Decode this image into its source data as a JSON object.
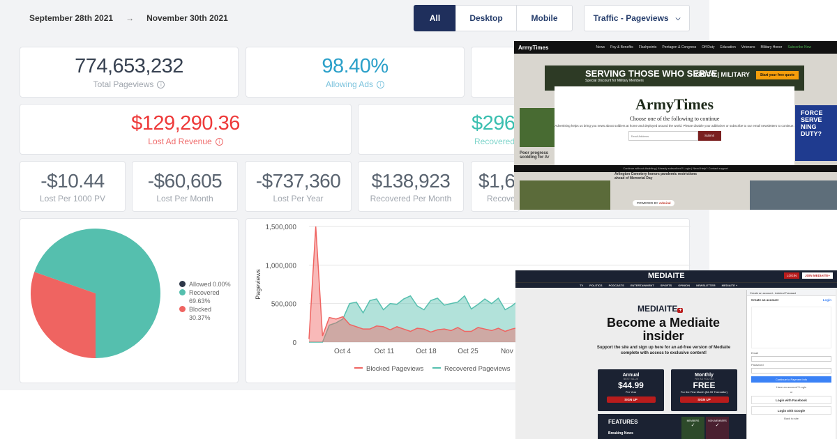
{
  "date_range": {
    "start": "September 28th 2021",
    "arrow": "→",
    "end": "November 30th 2021"
  },
  "device_filter": {
    "all": "All",
    "desktop": "Desktop",
    "mobile": "Mobile"
  },
  "metric_select": {
    "label": "Traffic - Pageviews"
  },
  "stats": {
    "total_pageviews": {
      "value": "774,653,232",
      "label": "Total Pageviews"
    },
    "allowing_ads": {
      "value": "98.40%",
      "label": "Allowing Ads"
    },
    "lost_ad_revenue": {
      "value": "$129,290.36",
      "label": "Lost Ad Revenue"
    },
    "recovered": {
      "value": "$296",
      "label": "Recovered"
    },
    "lost_per_1000": {
      "value": "-$10.44",
      "label": "Lost Per 1000 PV"
    },
    "lost_per_month": {
      "value": "-$60,605",
      "label": "Lost Per Month"
    },
    "lost_per_year": {
      "value": "-$737,360",
      "label": "Lost Per Year"
    },
    "recovered_per_month": {
      "value": "$138,923",
      "label": "Recovered Per Month"
    },
    "recovered_partial": {
      "value": "$1,6",
      "label": "Recove"
    }
  },
  "chart_data": [
    {
      "type": "pie",
      "labels": [
        "Allowed",
        "Recovered",
        "Blocked"
      ],
      "values": [
        0.0,
        69.63,
        30.37
      ],
      "value_labels": [
        "0.00%",
        "69.63%",
        "30.37%"
      ],
      "colors": [
        "#2d3748",
        "#55bfae",
        "#ef6461"
      ],
      "legend": "right"
    },
    {
      "type": "area",
      "ylabel": "Pageviews",
      "yticks": [
        "0",
        "500,000",
        "1,000,000",
        "1,500,000"
      ],
      "ylim": [
        0,
        1500000
      ],
      "xticks": [
        "Oct 4",
        "Oct 11",
        "Oct 18",
        "Oct 25",
        "Nov 1"
      ],
      "series": [
        {
          "name": "Blocked Pageviews",
          "color": "#ef6461",
          "values": [
            40000,
            1500000,
            80000,
            320000,
            300000,
            330000,
            230000,
            200000,
            170000,
            170000,
            210000,
            200000,
            160000,
            200000,
            170000,
            140000,
            180000,
            170000,
            130000,
            160000,
            170000,
            150000,
            190000,
            140000,
            140000,
            190000,
            170000,
            150000,
            180000,
            140000,
            170000,
            190000,
            160000,
            200000
          ]
        },
        {
          "name": "Recovered Pageviews",
          "color": "#55bfae",
          "values": [
            0,
            0,
            0,
            220000,
            250000,
            300000,
            500000,
            520000,
            380000,
            540000,
            560000,
            420000,
            500000,
            490000,
            560000,
            600000,
            470000,
            420000,
            540000,
            570000,
            480000,
            500000,
            520000,
            600000,
            430000,
            490000,
            560000,
            500000,
            570000,
            420000,
            470000,
            540000,
            500000,
            530000
          ]
        }
      ],
      "legend": "bottom"
    }
  ],
  "overlays": {
    "army_times": {
      "nav_logo": "ArmyTimes",
      "nav_items": [
        "News",
        "Pay & Benefits",
        "Flashpoints",
        "Pentagon & Congress",
        "Off Duty",
        "Education",
        "Veterans",
        "Military Honor",
        "Subscribe Now"
      ],
      "banner_title": "SERVING THOSE WHO SERVE",
      "banner_sub": "Special Discount for Military Members",
      "banner_brand": "GEICO | MILITARY",
      "banner_cta": "Start your free quote",
      "modal_title": "ArmyTimes",
      "modal_subtitle": "Choose one of the following to continue",
      "modal_text": "Advertising helps us bring you news about soldiers at home and deployed around the world. Please disable your adblocker or subscribe to our email newsletters to continue.",
      "email_placeholder": "Email Address",
      "submit": "Submit",
      "footer": "Continue without disabling | Already subscribed? Login | Need Help? Contact support",
      "side_promo": "FORCE SERVE NING DUTY?",
      "headline_left": "Poor progress scolding for Ar",
      "headline_mid": "Arlington Cemetery honors pandemic restrictions ahead of Memorial Day",
      "powered_by": "POWERED BY",
      "powered_brand": "Admiral"
    },
    "mediaite": {
      "logo": "MEDIAITE",
      "login": "LOGIN",
      "join": "JOIN MEDIAITE+",
      "nav": [
        "TV",
        "POLITICS",
        "PODCASTS",
        "ENTERTAINMENT",
        "SPORTS",
        "OPINION",
        "NEWSLETTER",
        "MEDIAITE +"
      ],
      "brand": "MEDIAITE",
      "brand_plus": "+",
      "headline": "Become a Mediaite insider",
      "pitch": "Support the site and sign up here for an ad-free version of Mediaite complete with access to exclusive content!",
      "annual": {
        "title": "Annual",
        "note": "BEST VALUE",
        "price": "$44.99",
        "unit": "Per Year",
        "cta": "SIGN UP"
      },
      "monthly": {
        "title": "Monthly",
        "note": "PAY AS YOU GO",
        "price": "FREE",
        "unit": "For the First Month ($4.99 Thereafter)",
        "cta": "SIGN UP"
      },
      "features": "FEATURES",
      "breaking": "Breaking News",
      "members": "MEMBERS",
      "non_members": "NON-MEMBERS",
      "panel": {
        "tab": "Create an account - Admiral Transact",
        "header": "Create an account",
        "login_link": "Login",
        "email": "Email",
        "password": "Password",
        "continue": "Continue to Payment Info",
        "have_account": "Have an account? Login",
        "or": "or",
        "facebook": "Login with Facebook",
        "google": "Login with Google",
        "back": "Back to site"
      }
    }
  }
}
